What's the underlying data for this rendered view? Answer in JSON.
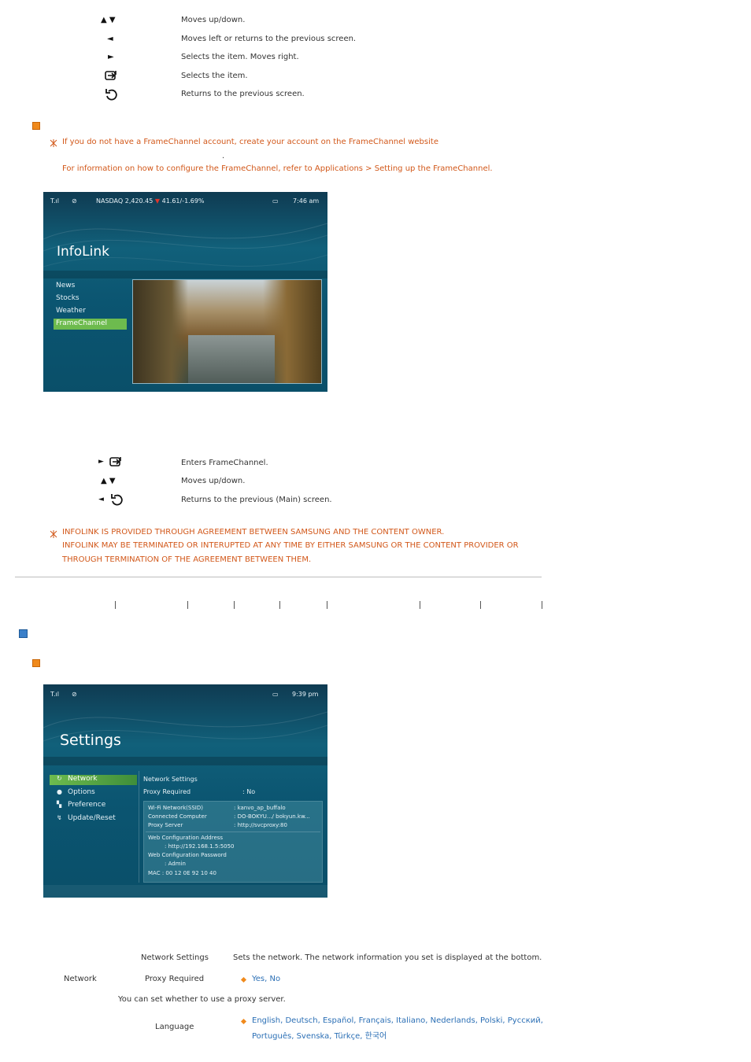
{
  "top_keys": [
    {
      "key": "▲ ▼",
      "desc": "Moves up/down."
    },
    {
      "key": "◄",
      "desc": "Moves left or returns to the previous screen."
    },
    {
      "key": "►",
      "desc": "Selects the item. Moves right."
    },
    {
      "key": "enter-icon",
      "desc": "Selects the item."
    },
    {
      "key": "return-icon",
      "desc": "Returns to the previous screen."
    }
  ],
  "note1": {
    "line1": "If you do not have a FrameChannel account, create your account on the FrameChannel website",
    "dot": ".",
    "line2": "For information on how to configure the FrameChannel, refer to Applications > Setting up the FrameChannel."
  },
  "infolink_screen": {
    "ticker": "NASDAQ 2,420.45",
    "ticker_change": "41.61/-1.69%",
    "time": "7:46 am",
    "title": "InfoLink",
    "menu": [
      "News",
      "Stocks",
      "Weather",
      "FrameChannel"
    ],
    "selected": 3
  },
  "mid_keys": [
    {
      "desc": "Enters FrameChannel."
    },
    {
      "key": "▲  ▼",
      "desc": "Moves up/down."
    },
    {
      "desc": "Returns to the previous (Main) screen."
    }
  ],
  "note2": {
    "line1": "INFOLINK IS PROVIDED THROUGH AGREEMENT BETWEEN SAMSUNG AND THE CONTENT OWNER.",
    "line2": "INFOLINK MAY BE TERMINATED OR INTERUPTED AT ANY TIME BY EITHER SAMSUNG OR THE CONTENT PROVIDER OR",
    "line3": "THROUGH TERMINATION OF THE AGREEMENT BETWEEN THEM."
  },
  "settings_screen": {
    "time": "9:39 pm",
    "title": "Settings",
    "menu": [
      "Network",
      "Options",
      "Preference",
      "Update/Reset"
    ],
    "selected": 0,
    "panel_heading": "Network Settings",
    "proxy_label": "Proxy Required",
    "proxy_value": ": No",
    "info_rows": [
      {
        "label": "Wi-Fi Network(SSID)",
        "value": ": kanvo_ap_buffalo"
      },
      {
        "label": "Connected Computer",
        "value": ": DO-BOKYU.../ bokyun.kw..."
      },
      {
        "label": "Proxy Server",
        "value": ": http://svcproxy:80"
      }
    ],
    "web_addr_label": "Web Configuration Address",
    "web_addr_value": ": http://192.168.1.5:5050",
    "web_pw_label": "Web Configuration Password",
    "web_pw_value": ": Admin",
    "mac": "MAC : 00 12 0E 92 10 40"
  },
  "table": {
    "r1_col2": "Network Settings",
    "r1_col3": "Sets the network. The network information you set is displayed at the bottom.",
    "r2_col1": "Network",
    "r2_col2": "Proxy Required",
    "r2_col3": "Yes, No",
    "r3_text": "You can set whether to use a proxy server.",
    "r4_col2": "Language",
    "r4_line1": "English, Deutsch, Español, Français, Italiano, Nederlands, Polski, Русский,",
    "r4_line2": "Português, Svenska, Türkçe, 한국어"
  },
  "colors": {
    "orange": "#d2581a",
    "blue": "#2b6fb5",
    "select_green": "#6dbb4e",
    "screen_teal": "#0b5571"
  }
}
